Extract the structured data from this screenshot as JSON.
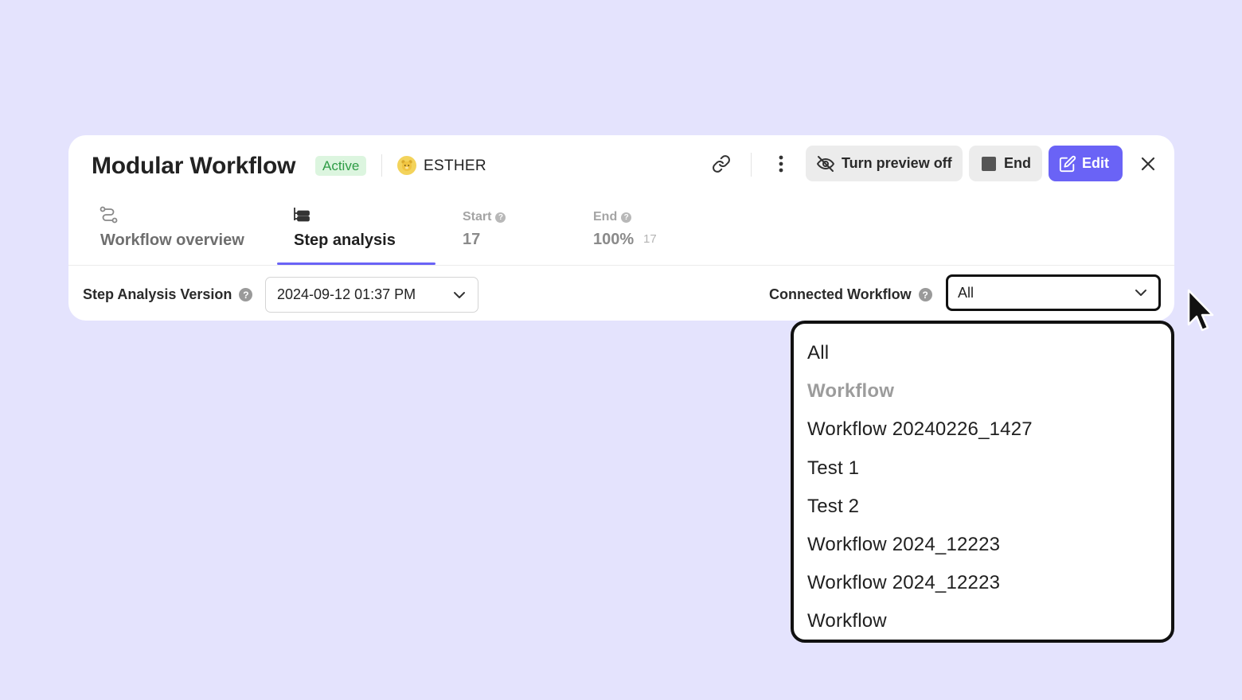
{
  "header": {
    "title": "Modular Workflow",
    "status_badge": "Active",
    "user": {
      "avatar_icon": "bear-avatar-icon",
      "name": "ESTHER"
    },
    "actions": {
      "link_icon": "link-icon",
      "more_icon": "more-vertical-icon",
      "preview_label": "Turn preview off",
      "preview_icon": "eye-off-icon",
      "end_label": "End",
      "end_icon": "stop-square-icon",
      "edit_label": "Edit",
      "edit_icon": "edit-pencil-icon",
      "close_icon": "close-icon"
    }
  },
  "tabs": [
    {
      "label": "Workflow overview",
      "icon": "workflow-path-icon",
      "active": false
    },
    {
      "label": "Step analysis",
      "icon": "step-list-icon",
      "active": true
    }
  ],
  "stats": {
    "start": {
      "label": "Start",
      "value": "17"
    },
    "end": {
      "label": "End",
      "value": "100%",
      "sub": "17"
    }
  },
  "filters": {
    "version": {
      "label": "Step Analysis Version",
      "value": "2024-09-12 01:37 PM"
    },
    "connected": {
      "label": "Connected Workflow",
      "value": "All"
    }
  },
  "dropdown": {
    "options": [
      {
        "label": "All",
        "type": "option"
      },
      {
        "label": "Workflow",
        "type": "group"
      },
      {
        "label": "Workflow 20240226_1427",
        "type": "option"
      },
      {
        "label": "Test 1",
        "type": "option"
      },
      {
        "label": "Test 2",
        "type": "option"
      },
      {
        "label": "Workflow 2024_12223",
        "type": "option"
      },
      {
        "label": "Workflow 2024_12223",
        "type": "option"
      },
      {
        "label": "Workflow",
        "type": "option"
      }
    ]
  },
  "colors": {
    "background": "#e4e3fd",
    "accent": "#6a63f6",
    "active_badge_bg": "#dcf5df",
    "active_badge_text": "#2e9c45"
  }
}
